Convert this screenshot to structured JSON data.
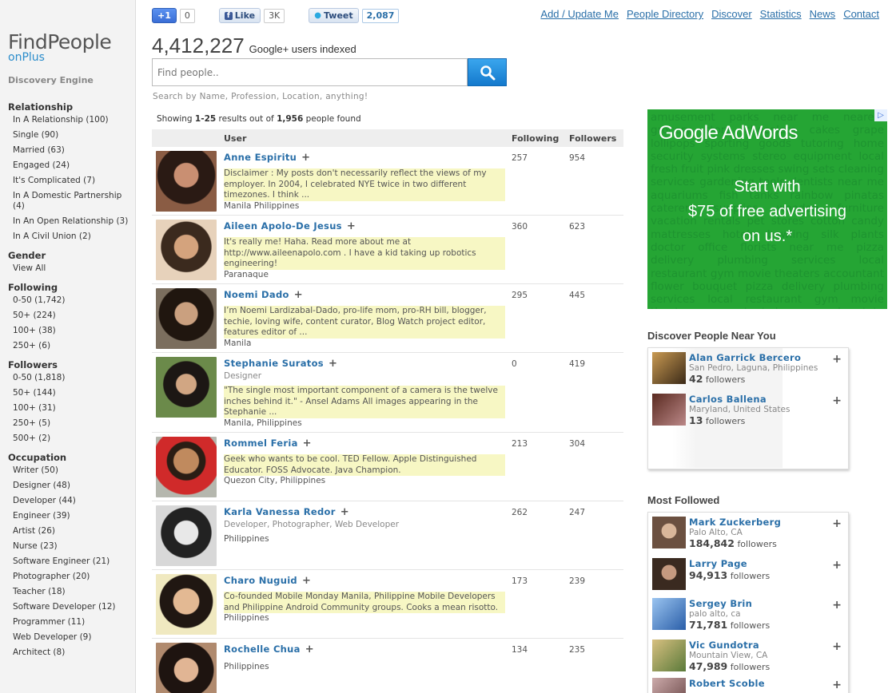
{
  "logo": {
    "main": "FindPeople",
    "sub": "onPlus",
    "tagline": "Discovery Engine"
  },
  "share": {
    "gplus": {
      "label": "+1",
      "count": "0"
    },
    "facebook": {
      "label": "Like",
      "count": "3K"
    },
    "twitter": {
      "label": "Tweet",
      "count": "2,087"
    }
  },
  "nav": [
    "Add / Update Me",
    "People Directory",
    "Discover",
    "Statistics",
    "News",
    "Contact"
  ],
  "stats": {
    "count": "4,412,227",
    "label": "Google+ users indexed"
  },
  "search": {
    "placeholder": "Find people..",
    "value": "Find people..",
    "hint": "Search by Name, Profession, Location, anything!"
  },
  "results_summary": {
    "prefix": "Showing",
    "range": "1-25",
    "mid": "results out of",
    "total": "1,956",
    "suffix": "people found"
  },
  "table_headers": {
    "user": "User",
    "following": "Following",
    "followers": "Followers"
  },
  "facets": [
    {
      "title": "Relationship",
      "items": [
        "In A Relationship (100)",
        "Single (90)",
        "Married (63)",
        "Engaged (24)",
        "It's Complicated (7)",
        "In A Domestic Partnership (4)",
        "In An Open Relationship (3)",
        "In A Civil Union (2)"
      ]
    },
    {
      "title": "Gender",
      "items": [
        "View All"
      ]
    },
    {
      "title": "Following",
      "items": [
        "0-50 (1,742)",
        "50+ (224)",
        "100+ (38)",
        "250+ (6)"
      ]
    },
    {
      "title": "Followers",
      "items": [
        "0-50 (1,818)",
        "50+ (144)",
        "100+ (31)",
        "250+ (5)",
        "500+ (2)"
      ]
    },
    {
      "title": "Occupation",
      "items": [
        "Writer (50)",
        "Designer (48)",
        "Developer (44)",
        "Engineer (39)",
        "Artist (26)",
        "Nurse (23)",
        "Software Engineer (21)",
        "Photographer (20)",
        "Teacher (18)",
        "Software Developer (12)",
        "Programmer (11)",
        "Web Developer (9)",
        "Architect (8)"
      ]
    }
  ],
  "results": [
    {
      "name": "Anne Espiritu",
      "sub": "",
      "bio": "Disclaimer : My posts don't necessarily reflect the views of my employer.    In 2004, I celebrated NYE twice in two different timezones. I think ...",
      "location": "Manila Philippines",
      "following": "257",
      "followers": "954"
    },
    {
      "name": "Aileen Apolo-De Jesus",
      "sub": "",
      "bio": "It's really me! Haha. Read more about me at http://www.aileenapolo.com .  I have a kid taking up robotics engineering!",
      "location": "Paranaque",
      "following": "360",
      "followers": "623"
    },
    {
      "name": "Noemi Dado",
      "sub": "",
      "bio": "I’m Noemi Lardizabal-Dado, pro-life mom, pro-RH bill, blogger, techie, loving wife, content curator, Blog Watch project editor, features editor of ...",
      "location": "Manila",
      "following": "295",
      "followers": "445"
    },
    {
      "name": "Stephanie Suratos",
      "sub": "Designer",
      "bio": "\"The single most important component of a camera is the twelve inches behind it.\" - Ansel Adams All images appearing in the Stephanie ...",
      "location": "Manila, Philippines",
      "following": "0",
      "followers": "419"
    },
    {
      "name": "Rommel Feria",
      "sub": "",
      "bio": "Geek who wants to be cool. TED Fellow. Apple Distinguished Educator. FOSS Advocate. Java Champion.",
      "location": "Quezon City, Philippines",
      "following": "213",
      "followers": "304"
    },
    {
      "name": "Karla Vanessa Redor",
      "sub": "Developer, Photographer, Web Developer",
      "bio": "",
      "location": "Philippines",
      "following": "262",
      "followers": "247"
    },
    {
      "name": "Charo Nuguid",
      "sub": "",
      "bio": "Co-founded Mobile Monday Manila, Philippine Mobile Developers and Philippine Android Community groups. Cooks a mean risotto.",
      "location": "Philippines",
      "following": "173",
      "followers": "239"
    },
    {
      "name": "Rochelle Chua",
      "sub": "",
      "bio": "",
      "location": "Philippines",
      "following": "134",
      "followers": "235"
    }
  ],
  "ad": {
    "brand": "Google AdWords",
    "lines": [
      "Start with",
      "$75 of free advertising",
      "on us.*"
    ],
    "background_text": "amusement parks near me nearest grocery store chocolate cakes grape lollipops sporting goods tutoring home security systems stereo equipment local fresh fruit pink dresses swing sets cleaning services gardening tools dentists near me aquariums fish tanks rainbow pinatas caterers supplies wooden furniture vacation rentals pet stores cotton candy mattresses hotels bowling silk plants doctor office florists near me pizza delivery plumbing services local restaurant gym movie theaters accountant flower bouquet pizza delivery plumbing services local restaurant gym movie theaters accountant lawyer real estate agent pet food store taxi",
    "color": "#25a534"
  },
  "near": {
    "title": "Discover People Near You",
    "people": [
      {
        "name": "Alan Garrick Bercero",
        "location": "San Pedro, Laguna, Philippines",
        "followers": "42",
        "followers_label": "followers"
      },
      {
        "name": "Carlos Ballena",
        "location": "Maryland, United States",
        "followers": "13",
        "followers_label": "followers"
      }
    ]
  },
  "most_followed": {
    "title": "Most Followed",
    "people": [
      {
        "name": "Mark Zuckerberg",
        "location": "Palo Alto, CA",
        "followers": "184,842",
        "followers_label": "followers"
      },
      {
        "name": "Larry Page",
        "location": "",
        "followers": "94,913",
        "followers_label": "followers"
      },
      {
        "name": "Sergey Brin",
        "location": "palo alto, ca",
        "followers": "71,781",
        "followers_label": "followers"
      },
      {
        "name": "Vic Gundotra",
        "location": "Mountain View, CA",
        "followers": "47,989",
        "followers_label": "followers"
      },
      {
        "name": "Robert Scoble",
        "location": "",
        "followers": "",
        "followers_label": ""
      }
    ]
  },
  "icons": {
    "search": "magnifier-icon",
    "add": "plus-icon"
  },
  "colors": {
    "link": "#2a6fa8",
    "search_button": "#1e8ee0",
    "bio_highlight": "#f7f7c4"
  }
}
